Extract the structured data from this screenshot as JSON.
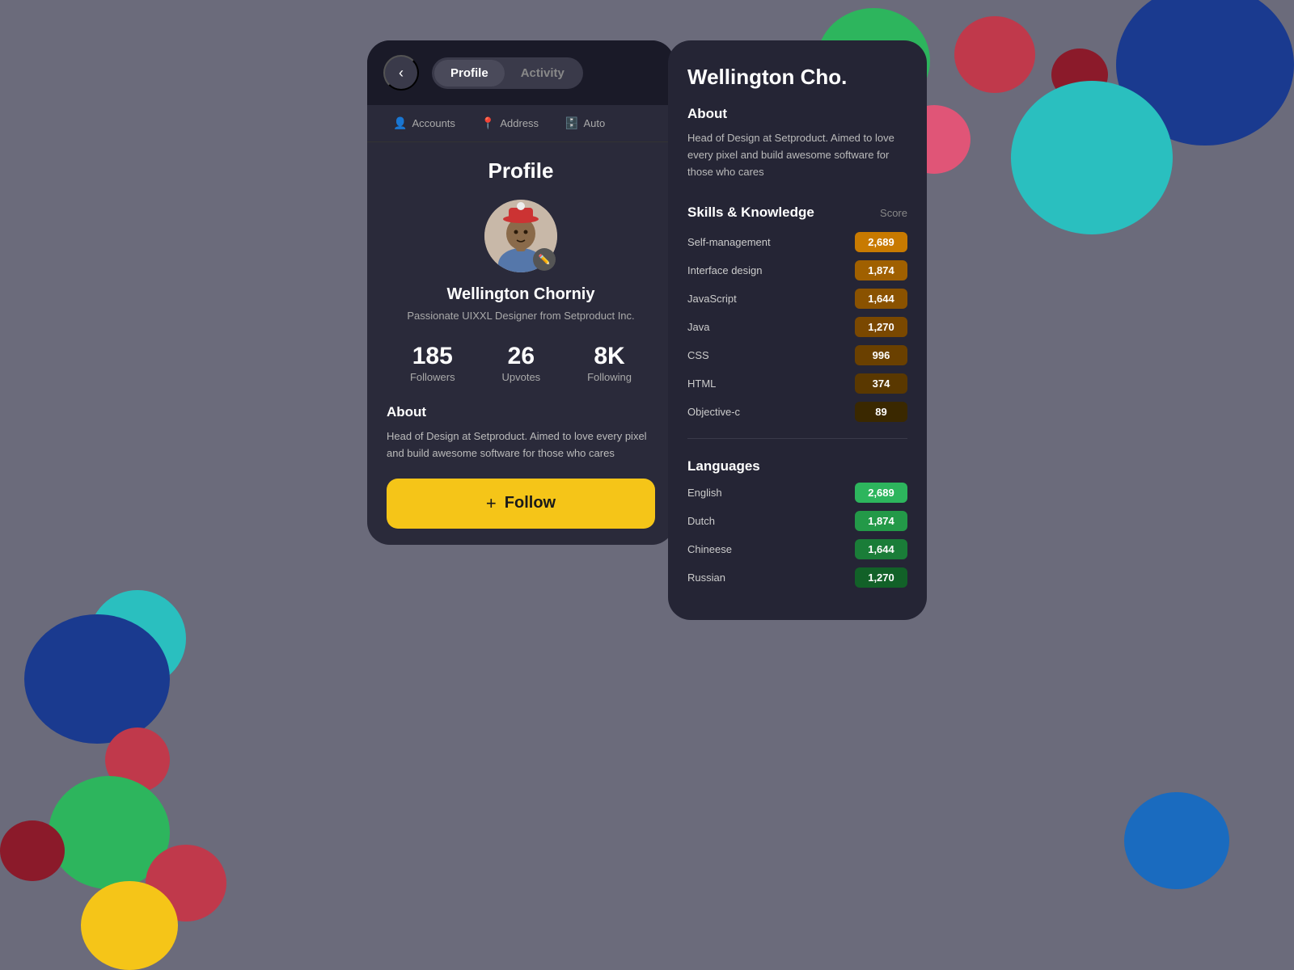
{
  "background_color": "#6b6b7b",
  "header": {
    "back_label": "‹",
    "tab_profile": "Profile",
    "tab_activity": "Activity"
  },
  "nav_tabs": [
    {
      "icon": "👤",
      "label": "Accounts"
    },
    {
      "icon": "📍",
      "label": "Address"
    },
    {
      "icon": "🗄️",
      "label": "Auto"
    }
  ],
  "profile": {
    "page_title": "Profile",
    "user_name": "Wellington Chorniy",
    "user_bio": "Passionate UIXXL Designer\nfrom Setproduct Inc.",
    "stats": [
      {
        "value": "185",
        "label": "Followers"
      },
      {
        "value": "26",
        "label": "Upvotes"
      },
      {
        "value": "8K",
        "label": "Following"
      }
    ],
    "about_title": "About",
    "about_text": "Head of Design at Setproduct. Aimed to love every pixel and build awesome software for those who cares",
    "follow_button": "+ Follow"
  },
  "detail": {
    "name": "Wellington Cho.",
    "about_title": "About",
    "about_text": "Head of Design at Setproduct. Aimed to love every pixel and build awesome software for those who cares",
    "skills_title": "Skills & Knowledge",
    "score_label": "Score",
    "skills": [
      {
        "name": "Self-management",
        "score": "2,689",
        "badge_class": "badge-orange"
      },
      {
        "name": "Interface design",
        "score": "1,874",
        "badge_class": "badge-dark-orange"
      },
      {
        "name": "JavaScript",
        "score": "1,644",
        "badge_class": "badge-darker-orange"
      },
      {
        "name": "Java",
        "score": "1,270",
        "badge_class": "badge-darkest-orange"
      },
      {
        "name": "CSS",
        "score": "996",
        "badge_class": "badge-olive"
      },
      {
        "name": "HTML",
        "score": "374",
        "badge_class": "badge-olive-dark"
      },
      {
        "name": "Objective-c",
        "score": "89",
        "badge_class": "badge-very-dark"
      }
    ],
    "languages_title": "Languages",
    "languages": [
      {
        "name": "English",
        "score": "2,689",
        "badge_class": "badge-green"
      },
      {
        "name": "Dutch",
        "score": "1,874",
        "badge_class": "badge-green-dark"
      },
      {
        "name": "Chineese",
        "score": "1,644",
        "badge_class": "badge-green-darker"
      },
      {
        "name": "Russian",
        "score": "1,270",
        "badge_class": "badge-green-darkest"
      }
    ]
  }
}
